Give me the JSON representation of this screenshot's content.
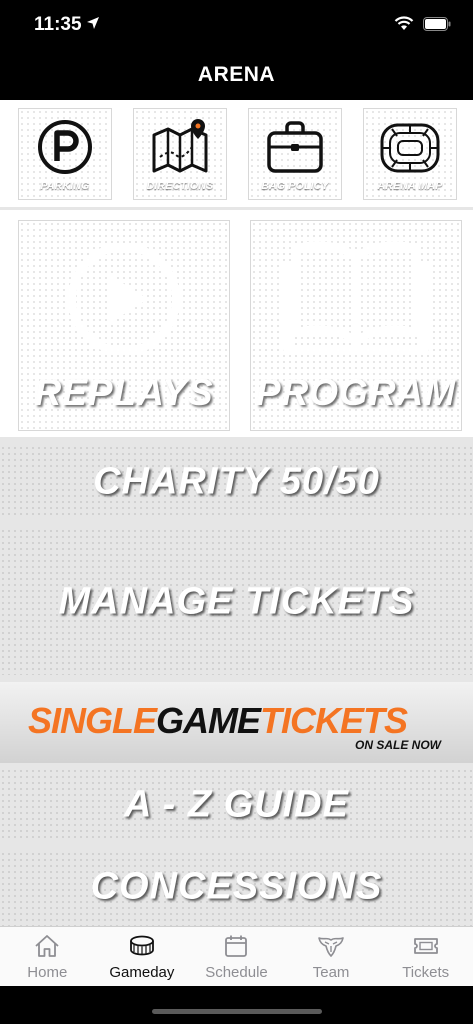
{
  "status_bar": {
    "time": "11:35"
  },
  "nav": {
    "title": "ARENA"
  },
  "quick_tiles": [
    {
      "label": "PARKING",
      "icon": "parking-icon"
    },
    {
      "label": "DIRECTIONS",
      "icon": "map-pin-icon"
    },
    {
      "label": "BAG POLICY",
      "icon": "bag-icon"
    },
    {
      "label": "ARENA MAP",
      "icon": "arena-map-icon"
    }
  ],
  "feature_tiles": [
    {
      "label": "REPLAYS",
      "icon": "play-icon"
    },
    {
      "label": "PROGRAM",
      "icon": "book-icon"
    }
  ],
  "banners": {
    "charity": "CHARITY 50/50",
    "manage_tickets": "MANAGE TICKETS",
    "az_guide": "A - Z GUIDE",
    "concessions": "CONCESSIONS"
  },
  "promo": {
    "word1": "SINGLE",
    "word2": "GAME",
    "word3": "TICKETS",
    "subtitle": "ON SALE NOW",
    "colors": {
      "orange": "#f47422",
      "dark": "#111111"
    }
  },
  "tabs": [
    {
      "label": "Home",
      "icon": "house-icon",
      "active": false
    },
    {
      "label": "Gameday",
      "icon": "puck-icon",
      "active": true
    },
    {
      "label": "Schedule",
      "icon": "calendar-icon",
      "active": false
    },
    {
      "label": "Team",
      "icon": "team-logo-icon",
      "active": false
    },
    {
      "label": "Tickets",
      "icon": "ticket-icon",
      "active": false
    }
  ],
  "colors": {
    "brand_orange": "#f47422",
    "nav_bg": "#000000",
    "tab_active": "#111111",
    "tab_inactive": "#8e8e93"
  }
}
